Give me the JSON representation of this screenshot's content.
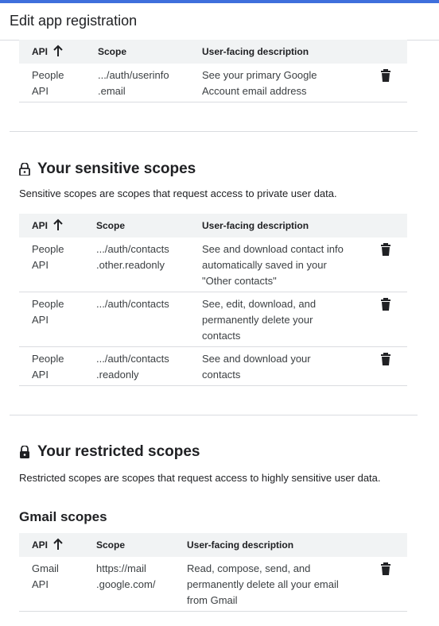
{
  "header": {
    "title": "Edit app registration"
  },
  "columns": {
    "api": "API",
    "scope": "Scope",
    "desc": "User-facing description"
  },
  "non_sensitive": {
    "rows": [
      {
        "api": [
          "People",
          "API"
        ],
        "scope": [
          ".../auth/userinfo",
          ".email"
        ],
        "desc": [
          "See your primary Google",
          "Account email address"
        ]
      }
    ]
  },
  "sensitive": {
    "title": "Your sensitive scopes",
    "description": "Sensitive scopes are scopes that request access to private user data.",
    "rows": [
      {
        "api": [
          "People",
          "API"
        ],
        "scope": [
          ".../auth/contacts",
          ".other.readonly"
        ],
        "desc": [
          "See and download contact info",
          "automatically saved in your",
          "\"Other contacts\""
        ]
      },
      {
        "api": [
          "People",
          "API"
        ],
        "scope": [
          ".../auth/contacts"
        ],
        "desc": [
          "See, edit, download, and",
          "permanently delete your",
          "contacts"
        ]
      },
      {
        "api": [
          "People",
          "API"
        ],
        "scope": [
          ".../auth/contacts",
          ".readonly"
        ],
        "desc": [
          "See and download your",
          "contacts"
        ]
      }
    ]
  },
  "restricted": {
    "title": "Your restricted scopes",
    "description": "Restricted scopes are scopes that request access to highly sensitive user data.",
    "gmail_title": "Gmail scopes",
    "rows": [
      {
        "api": [
          "Gmail",
          "API"
        ],
        "scope": [
          "https://mail",
          ".google.com/"
        ],
        "desc": [
          "Read, compose, send, and",
          "permanently delete all your email",
          "from Gmail"
        ]
      }
    ]
  },
  "icons": {
    "sort": "arrow-up-icon",
    "delete": "trash-icon",
    "sensitive_lock": "lock-open-icon",
    "restricted_lock": "lock-icon"
  },
  "colors": {
    "accent": "#3f6fdc",
    "header_bg": "#f1f3f4",
    "divider": "#dadce0"
  }
}
